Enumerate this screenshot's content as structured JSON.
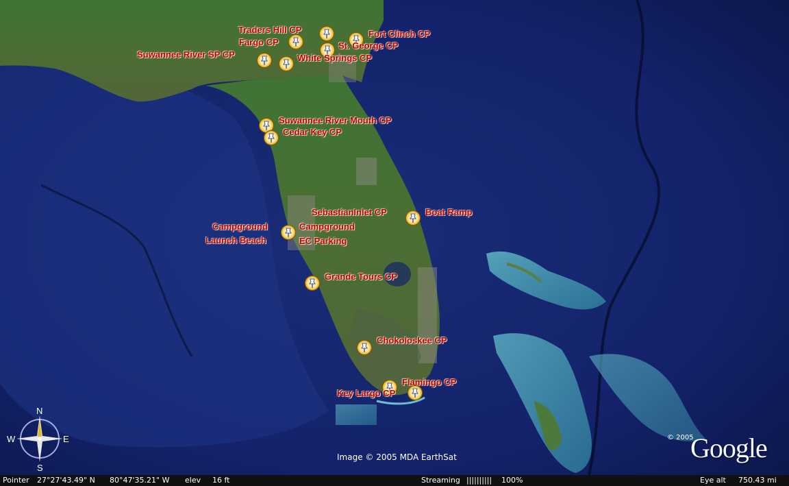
{
  "placemarks": [
    {
      "label": "Traders Hill CP"
    },
    {
      "label": "Fort Clinch CP"
    },
    {
      "label": "Fargo CP"
    },
    {
      "label": "St. George CP"
    },
    {
      "label": "Suwannee River SP CP"
    },
    {
      "label": "White Springs CP"
    },
    {
      "label": "Suwannee River Mouth CP"
    },
    {
      "label": "Cedar Key CP"
    },
    {
      "label": "SebastianInlet CP"
    },
    {
      "label": "Boat Ramp"
    },
    {
      "label": "Campground"
    },
    {
      "label": "Campground"
    },
    {
      "label": "Launch Beach"
    },
    {
      "label": "EC Parking"
    },
    {
      "label": "Grande Tours CP"
    },
    {
      "label": "Chokoloskee CP"
    },
    {
      "label": "Flamingo CP"
    },
    {
      "label": "Key Largo CP"
    }
  ],
  "compass": {
    "n": "N",
    "s": "S",
    "e": "E",
    "w": "W"
  },
  "imagery_credit": "Image © 2005 MDA EarthSat",
  "brand": {
    "logo": "Google",
    "copyright": "© 2005"
  },
  "statusbar": {
    "pointer_label": "Pointer",
    "pointer_lat": "27°27'43.49\" N",
    "pointer_lon": "80°47'35.21\" W",
    "elev_label": "elev",
    "elev_value": "16 ft",
    "streaming_label": "Streaming",
    "streaming_bar": "||||||||||",
    "streaming_pct": "100%",
    "eye_alt_label": "Eye  alt",
    "eye_alt_value": "750.43 mi"
  },
  "colors": {
    "label": "#c00000",
    "ocean": "#101c58",
    "land": "#3d6a2a",
    "status_bg": "#111111"
  },
  "icons": {
    "placemark": "pushpin-icon",
    "compass": "compass-rose-icon"
  }
}
